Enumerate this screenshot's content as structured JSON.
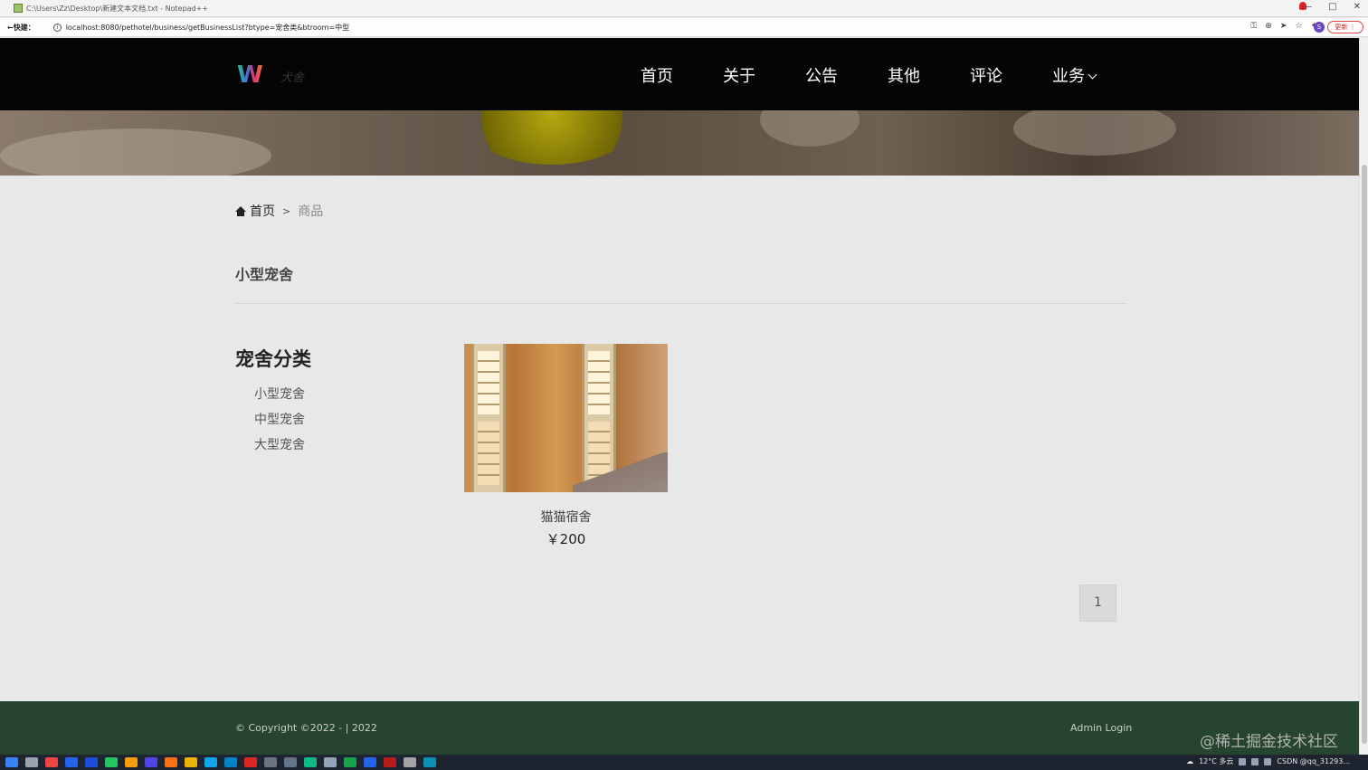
{
  "window": {
    "title": "C:\\Users\\Zz\\Desktop\\新建文本文档.txt - Notepad++",
    "controls": [
      "—",
      "□",
      "✕"
    ]
  },
  "browser": {
    "back_label": "←快建：",
    "url": "localhost:8080/pethotel/business/getBusinessList?btype=宠舍类&btroom=中型",
    "avatar_letter": "S",
    "update_label": "更新 ⋮",
    "tool_icons": [
      "key-icon",
      "zoom-icon",
      "send-icon",
      "star-icon",
      "extension-icon"
    ]
  },
  "header": {
    "logo_letter": "W",
    "logo_text": "犬舍",
    "nav": [
      "首页",
      "关于",
      "公告",
      "其他",
      "评论",
      "业务"
    ]
  },
  "breadcrumb": {
    "home": "首页",
    "separator": ">",
    "current": "商品"
  },
  "page": {
    "heading": "小型宠舍"
  },
  "sidebar": {
    "title": "宠舍分类",
    "categories": [
      "小型宠舍",
      "中型宠舍",
      "大型宠舍"
    ]
  },
  "products": [
    {
      "name": "猫猫宿舍",
      "price": "￥200"
    }
  ],
  "pagination": {
    "current": "1"
  },
  "footer": {
    "copyright": "© Copyright ©2022 - | 2022",
    "admin_link": "Admin Login"
  },
  "watermark": "@稀土掘金技术社区",
  "taskbar": {
    "weather": "12°C 多云",
    "tray_text": "CSDN @qq_31293..."
  },
  "colors": {
    "header_bg": "#050505",
    "footer_bg": "#27442f",
    "page_bg": "#e9e8e8"
  }
}
